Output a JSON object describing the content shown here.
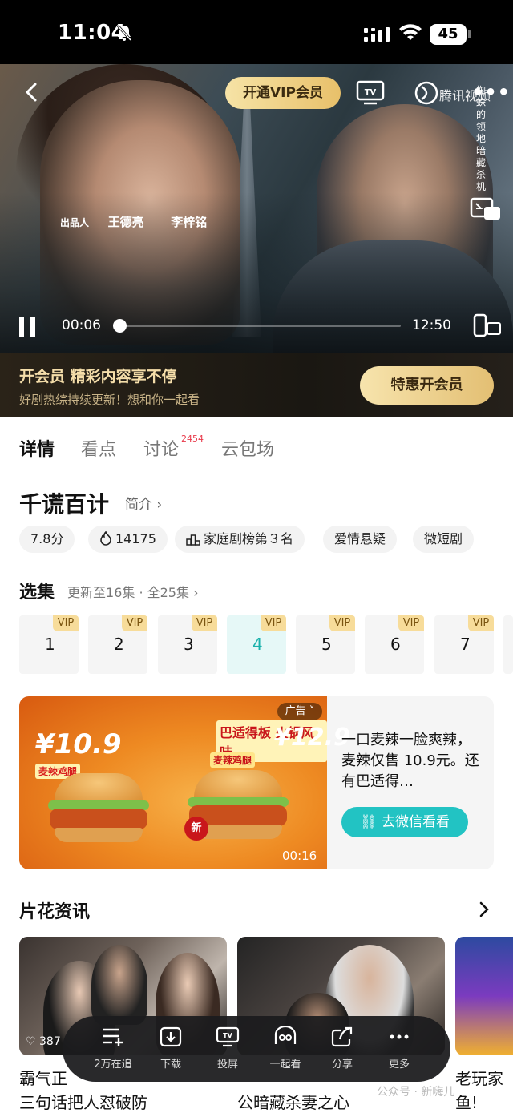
{
  "status_bar": {
    "time": "11:04",
    "battery": "45"
  },
  "player": {
    "vip_button": "开通VIP会员",
    "tencent_label": "腾讯视频",
    "credits": {
      "label": "出品人",
      "name1": "王德亮",
      "name2": "李梓铭"
    },
    "vertical_text": "蜘蛛的领地暗藏杀机",
    "current_time": "00:06",
    "total_time": "12:50",
    "progress_fraction": 0.008
  },
  "member_banner": {
    "title": "开会员 精彩内容享不停",
    "subtitle": "好剧热综持续更新！想和你一起看",
    "button": "特惠开会员"
  },
  "tabs": [
    {
      "label": "详情",
      "active": true
    },
    {
      "label": "看点",
      "active": false
    },
    {
      "label": "讨论",
      "active": false,
      "badge": "2454"
    },
    {
      "label": "云包场",
      "active": false
    }
  ],
  "show": {
    "title": "千谎百计",
    "intro_link": "简介 ›",
    "tags": [
      {
        "icon": "",
        "text": "7.8分"
      },
      {
        "icon": "fire-icon",
        "text": "14175"
      },
      {
        "icon": "ranking-icon",
        "text": "家庭剧榜第３名"
      },
      {
        "icon": "",
        "text": "爱情悬疑"
      },
      {
        "icon": "",
        "text": "微短剧"
      }
    ]
  },
  "episodes": {
    "title": "选集",
    "info": "更新至16集 · 全25集 ›",
    "vip_label": "VIP",
    "selected": 4,
    "items": [
      "1",
      "2",
      "3",
      "4",
      "5",
      "6",
      "7"
    ]
  },
  "ad": {
    "tag": "广告",
    "price_left": "¥10.9",
    "price_right": "¥12.9",
    "label_left": "麦辣鸡腿",
    "label_right": "麦辣鸡腿",
    "slogan": "巴适得板 火锅风味",
    "new_badge": "新",
    "duration": "00:16",
    "text": "一口麦辣一脸爽辣，麦辣仅售 10.9元。还有巴适得…",
    "button": "去微信看看"
  },
  "trailers": {
    "title": "片花资讯",
    "likes": "387",
    "captions": [
      {
        "line1": "霸气正义",
        "line2": "三句话把人怼破防"
      },
      {
        "line1": "",
        "line2": "公暗藏杀妻之心"
      },
      {
        "line1": "老玩家",
        "line2": "鱼!"
      }
    ]
  },
  "toolbar": [
    {
      "icon": "add-list-icon",
      "label": "2万在追"
    },
    {
      "icon": "download-icon",
      "label": "下载"
    },
    {
      "icon": "cast-screen-icon",
      "label": "投屏"
    },
    {
      "icon": "watch-together-icon",
      "label": "一起看"
    },
    {
      "icon": "share-icon",
      "label": "分享"
    },
    {
      "icon": "more-icon",
      "label": "更多"
    }
  ],
  "watermark": "公众号 · 新嗨儿",
  "colors": {
    "accent": "#1bb2ac",
    "vip_gold": "#e8c06a",
    "badge_red": "#e8394a"
  }
}
